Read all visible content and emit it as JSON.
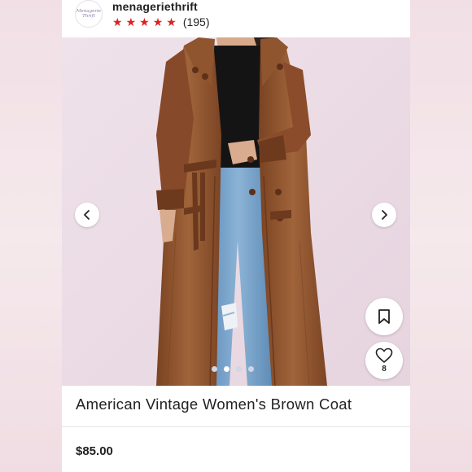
{
  "seller": {
    "username": "menageriethrift",
    "avatar_text": "Menagerie Thrift",
    "rating_stars": 5,
    "review_count": "(195)"
  },
  "listing": {
    "title": "American Vintage Women's Brown Coat",
    "price": "$85.00",
    "like_count": "8"
  },
  "carousel": {
    "total_images": 4,
    "active_index": 1
  },
  "icons": {
    "prev": "chevron-left-icon",
    "next": "chevron-right-icon",
    "bookmark": "bookmark-icon",
    "like": "heart-icon",
    "star": "star-icon"
  },
  "colors": {
    "star": "#e01f1f",
    "background": "#f3e6ea",
    "photo_bg": "#ecdde6",
    "coat": "#8a4f2b",
    "jeans": "#6f9cc6"
  }
}
